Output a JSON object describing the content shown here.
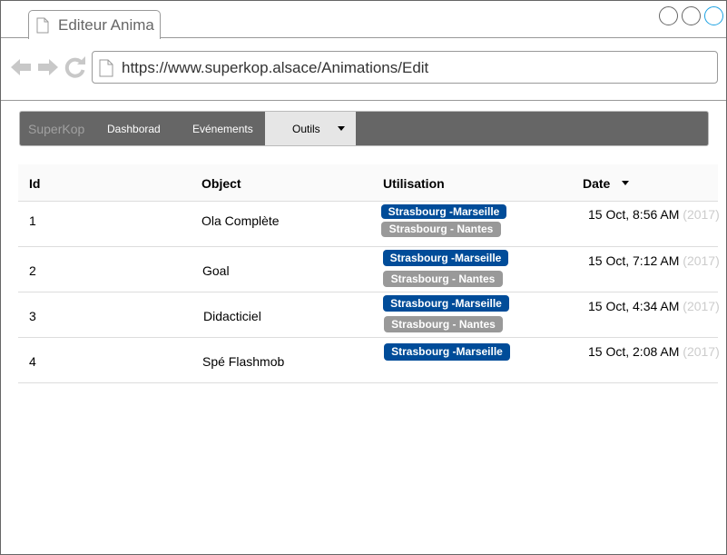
{
  "browser": {
    "tab_title": "Editeur Anima",
    "url": "https://www.superkop.alsace/Animations/Edit",
    "icons": [
      "document-icon",
      "back-arrow-icon",
      "forward-arrow-icon",
      "reload-icon"
    ]
  },
  "menu": {
    "brand": "SuperKop",
    "items": [
      "Dashborad",
      "Evénements"
    ],
    "active_label": "Outils"
  },
  "table": {
    "headers": {
      "id": "Id",
      "object": "Object",
      "utilisation": "Utilisation",
      "date": "Date"
    },
    "rows": [
      {
        "id": "1",
        "object": "Ola Complète",
        "badges": [
          "Strasbourg -Marseille",
          "Strasbourg - Nantes"
        ],
        "date": "15 Oct, 8:56 AM",
        "year": "(2017)"
      },
      {
        "id": "2",
        "object": "Goal",
        "badges": [
          "Strasbourg -Marseille",
          "Strasbourg - Nantes"
        ],
        "date": "15 Oct, 7:12 AM",
        "year": "(2017)"
      },
      {
        "id": "3",
        "object": "Didacticiel",
        "badges": [
          "Strasbourg -Marseille",
          "Strasbourg - Nantes"
        ],
        "date": "15 Oct, 4:34 AM",
        "year": "(2017)"
      },
      {
        "id": "4",
        "object": "Spé Flashmob",
        "badges": [
          "Strasbourg -Marseille"
        ],
        "date": "15 Oct, 2:08 AM",
        "year": "(2017)"
      }
    ]
  },
  "colors": {
    "menubar": "#666666",
    "badge_primary": "#004c99",
    "badge_secondary": "#999999",
    "year_text": "#cccccc",
    "window_control_accent": "#1ba1e2"
  }
}
